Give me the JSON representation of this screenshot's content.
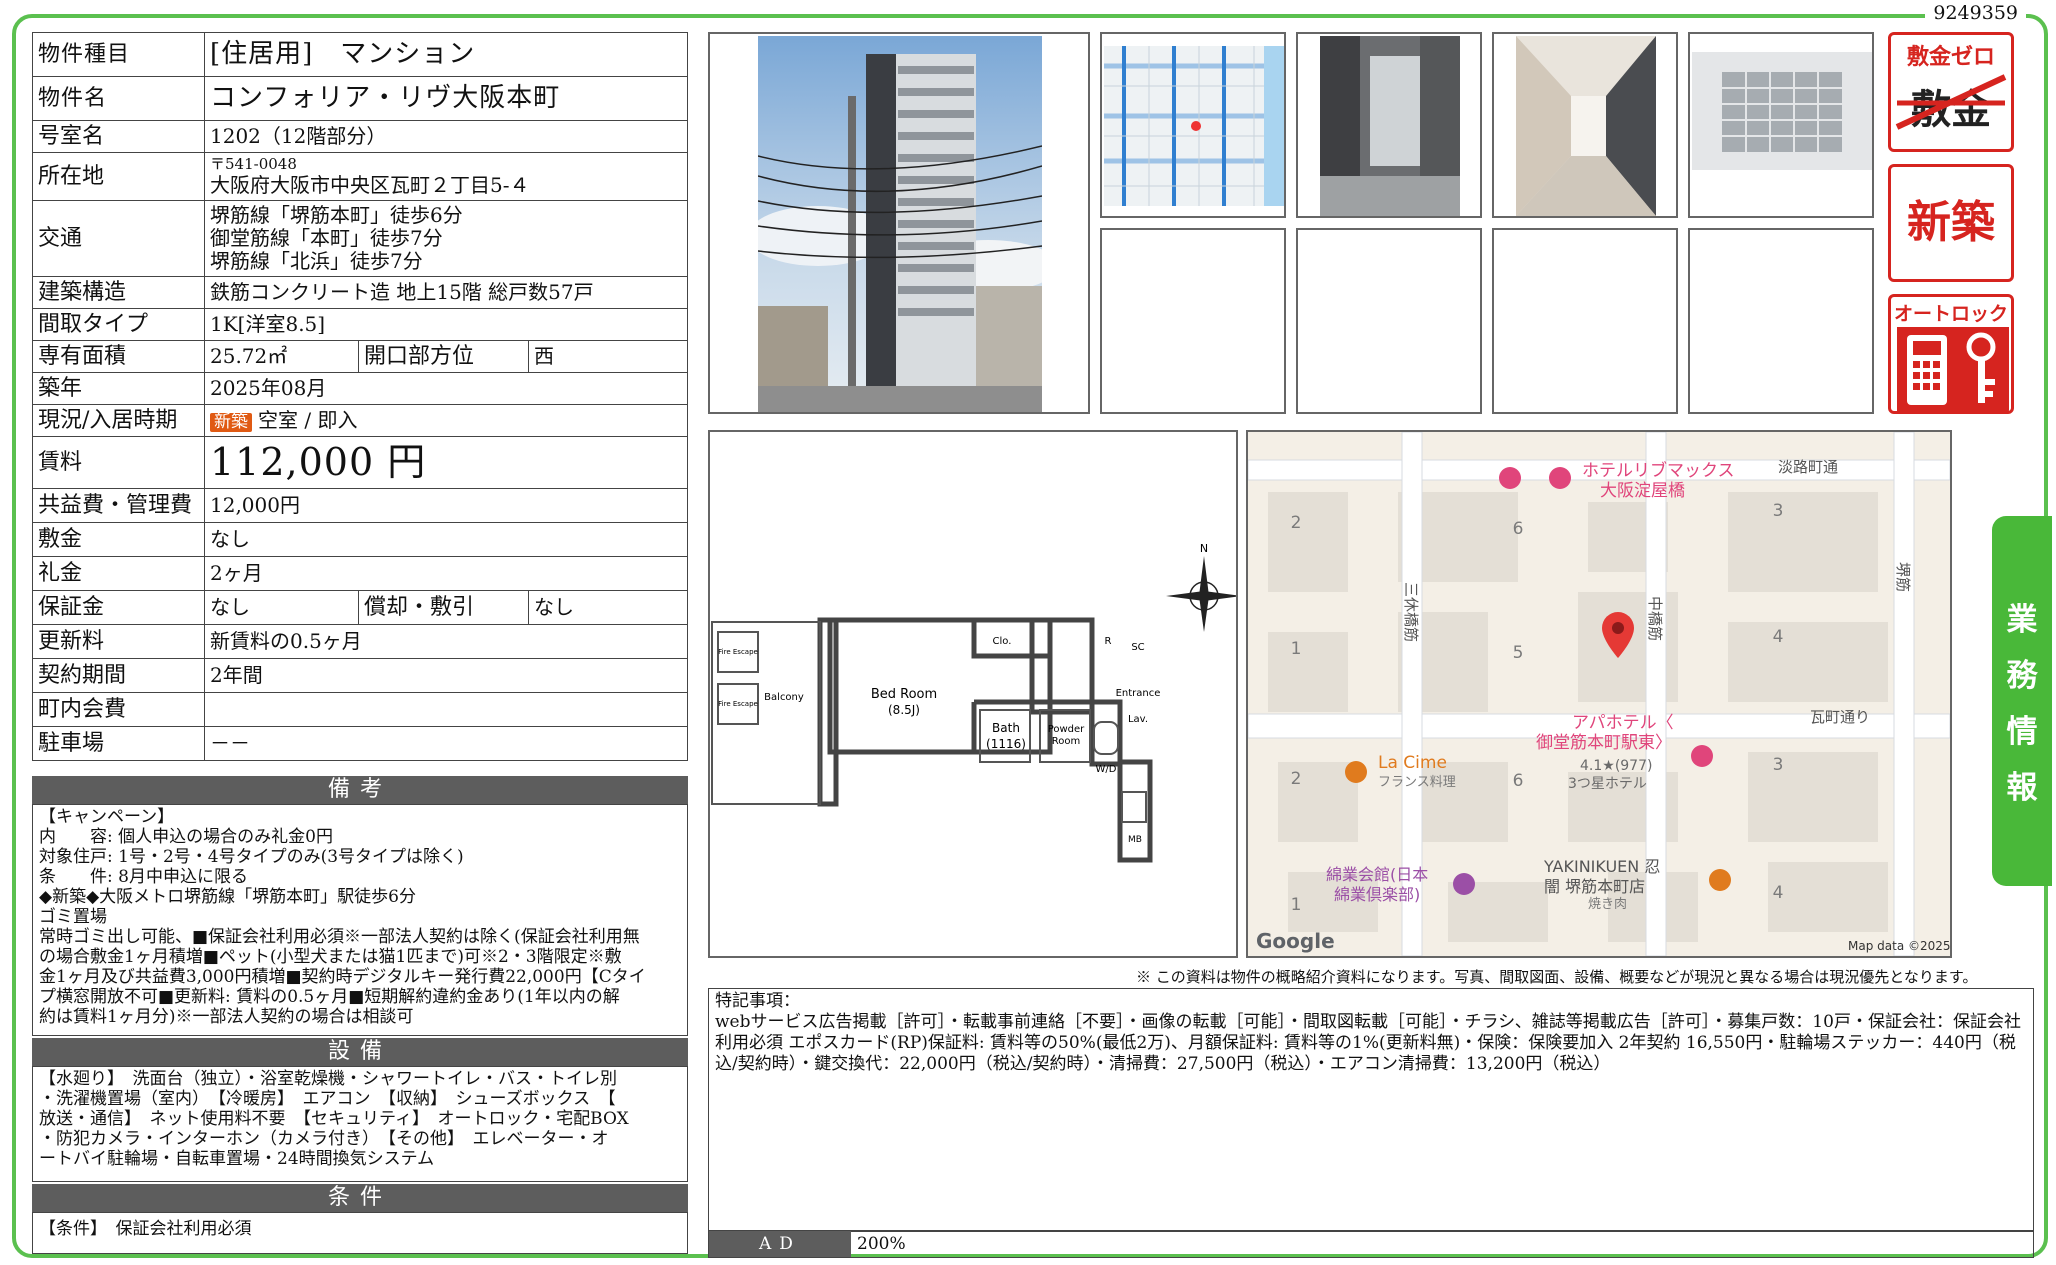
{
  "doc_id": "9249359",
  "property": {
    "type_label": "物件種目",
    "type_value": "[住居用]　マンション",
    "name_label": "物件名",
    "name_value": "コンフォリア・リヴ大阪本町",
    "room_label": "号室名",
    "room_value": "1202（12階部分）",
    "address_label": "所在地",
    "postal": "〒541-0048",
    "address": "大阪府大阪市中央区瓦町２丁目5-４",
    "transit_label": "交通",
    "transit": [
      "堺筋線「堺筋本町」徒歩6分",
      "御堂筋線「本町」徒歩7分",
      "堺筋線「北浜」徒歩7分"
    ],
    "structure_label": "建築構造",
    "structure_value": "鉄筋コンクリート造 地上15階 総戸数57戸",
    "layout_label": "間取タイプ",
    "layout_value": "1K[洋室8.5]",
    "area_label": "専有面積",
    "area_value": "25.72㎡",
    "direction_label": "開口部方位",
    "direction_value": "西",
    "built_label": "築年",
    "built_value": "2025年08月",
    "status_label": "現況/入居時期",
    "status_badge": "新築",
    "status_value": "空室 / 即入",
    "rent_label": "賃料",
    "rent_value": "112,000 円",
    "fee_label": "共益費・管理費",
    "fee_value": "12,000円",
    "deposit_label": "敷金",
    "deposit_value": "なし",
    "key_money_label": "礼金",
    "key_money_value": "2ヶ月",
    "guarantee_label": "保証金",
    "guarantee_value": "なし",
    "amort_label": "償却・敷引",
    "amort_value": "なし",
    "renewal_label": "更新料",
    "renewal_value": "新賃料の0.5ヶ月",
    "contract_label": "契約期間",
    "contract_value": "2年間",
    "town_fee_label": "町内会費",
    "town_fee_value": "",
    "parking_label": "駐車場",
    "parking_value": "－－"
  },
  "remarks": {
    "title": "備考",
    "lines": [
      "【キャンペーン】",
      "内　　容: 個人申込の場合のみ礼金0円",
      "対象住戸: 1号・2号・4号タイプのみ(3号タイプは除く)",
      "条　　件: 8月中申込に限る",
      "◆新築◆大阪メトロ堺筋線「堺筋本町」駅徒歩6分",
      "ゴミ置場",
      "常時ゴミ出し可能、■保証会社利用必須※一部法人契約は除く(保証会社利用無",
      "の場合敷金1ヶ月積増■ペット(小型犬または猫1匹まで)可※2・3階限定※敷",
      "金1ヶ月及び共益費3,000円積増■契約時デジタルキー発行費22,000円【Cタイ",
      "プ横窓開放不可■更新料: 賃料の0.5ヶ月■短期解約違約金あり(1年以内の解",
      "約は賃料1ヶ月分)※一部法人契約の場合は相談可"
    ]
  },
  "equipment": {
    "title": "設備",
    "lines": [
      "【水廻り】　洗面台（独立）・浴室乾燥機・シャワートイレ・バス・トイレ別",
      "・洗濯機置場（室内）　【冷暖房】　エアコン　【収納】　シューズボックス　【",
      "放送・通信】　ネット使用料不要　【セキュリティ】　オートロック・宅配BOX",
      "・防犯カメラ・インターホン（カメラ付き）　【その他】　エレベーター・オ",
      "ートバイ駐輪場・自転車置場・24時間換気システム"
    ]
  },
  "conditions": {
    "title": "条件",
    "lines": [
      "【条件】　保証会社利用必須"
    ]
  },
  "badges": {
    "zero": "敷金ゼロ",
    "zero_crossed": "敷金",
    "new": "新築",
    "autolock": "オートロック"
  },
  "side_tab": [
    "業",
    "務",
    "情",
    "報"
  ],
  "floorplan": {
    "north": "N",
    "rooms": [
      "Bed Room",
      "(8.5J)",
      "Balcony",
      "Bath",
      "(1116)",
      "Powder",
      "Room",
      "Clo.",
      "R",
      "SC",
      "Entrance",
      "Lav.",
      "W/D",
      "MB",
      "Fire Escape",
      "Fire Escape"
    ]
  },
  "map": {
    "hotel_top": "ホテルリブマックス",
    "hotel_top2": "大阪淀屋橋",
    "street_awaji": "淡路町通",
    "street_sanpo": "三休橋筋",
    "street_naka": "中橋筋",
    "street_sakai": "堺筋",
    "street_kawara": "瓦町通り",
    "apa1": "アパホテル〈",
    "apa2": "御堂筋本町駅東〉",
    "apa3": "4.1★(977)",
    "apa4": "3つ星ホテル",
    "lacime": "La Cime",
    "lacime2": "フランス料理",
    "menkai1": "綿業会館(日本",
    "menkai2": "綿業倶楽部)",
    "yaki1": "YAKINIKUEN 忍",
    "yaki2": "闇 堺筋本町店",
    "yaki3": "焼き肉",
    "blocks": [
      "2",
      "6",
      "3",
      "1",
      "5",
      "4",
      "2",
      "6",
      "3",
      "1",
      "4"
    ],
    "google": "Google",
    "mapdata": "Map data ©2025"
  },
  "disclaimer": "※ この資料は物件の概略紹介資料になります。写真、間取図面、設備、概要などが現況と異なる場合は現況優先となります。",
  "special": {
    "title": "特記事項：",
    "body": "webサービス広告掲載［許可］・転載事前連絡［不要］・画像の転載［可能］・間取図転載［可能］・チラシ、雑誌等掲載広告［許可］・募集戸数：10戸・保証会社：保証会社利用必須 エポスカード(RP)保証料: 賃料等の50%(最低2万)、月額保証料: 賃料等の1%(更新料無)・保険：保険要加入 2年契約 16,550円・駐輪場ステッカー：440円（税込/契約時）・鍵交換代：22,000円（税込/契約時）・清掃費：27,500円（税込）・エアコン清掃費：13,200円（税込）"
  },
  "ad": {
    "label": "AD",
    "value": "200%"
  },
  "colors": {
    "frame": "#5bc04f",
    "badge": "#d6241f",
    "header": "#5d5d5d",
    "side_tab": "#49b839",
    "new_badge": "#e05a13"
  }
}
